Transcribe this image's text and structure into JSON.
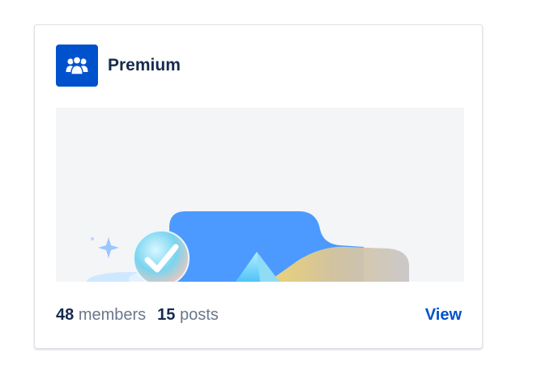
{
  "card": {
    "title": "Premium",
    "icon": "people-group-icon",
    "accent_color": "#0052cc",
    "stats": {
      "members_count": "48",
      "members_label": "members",
      "posts_count": "15",
      "posts_label": "posts"
    },
    "view_label": "View"
  }
}
